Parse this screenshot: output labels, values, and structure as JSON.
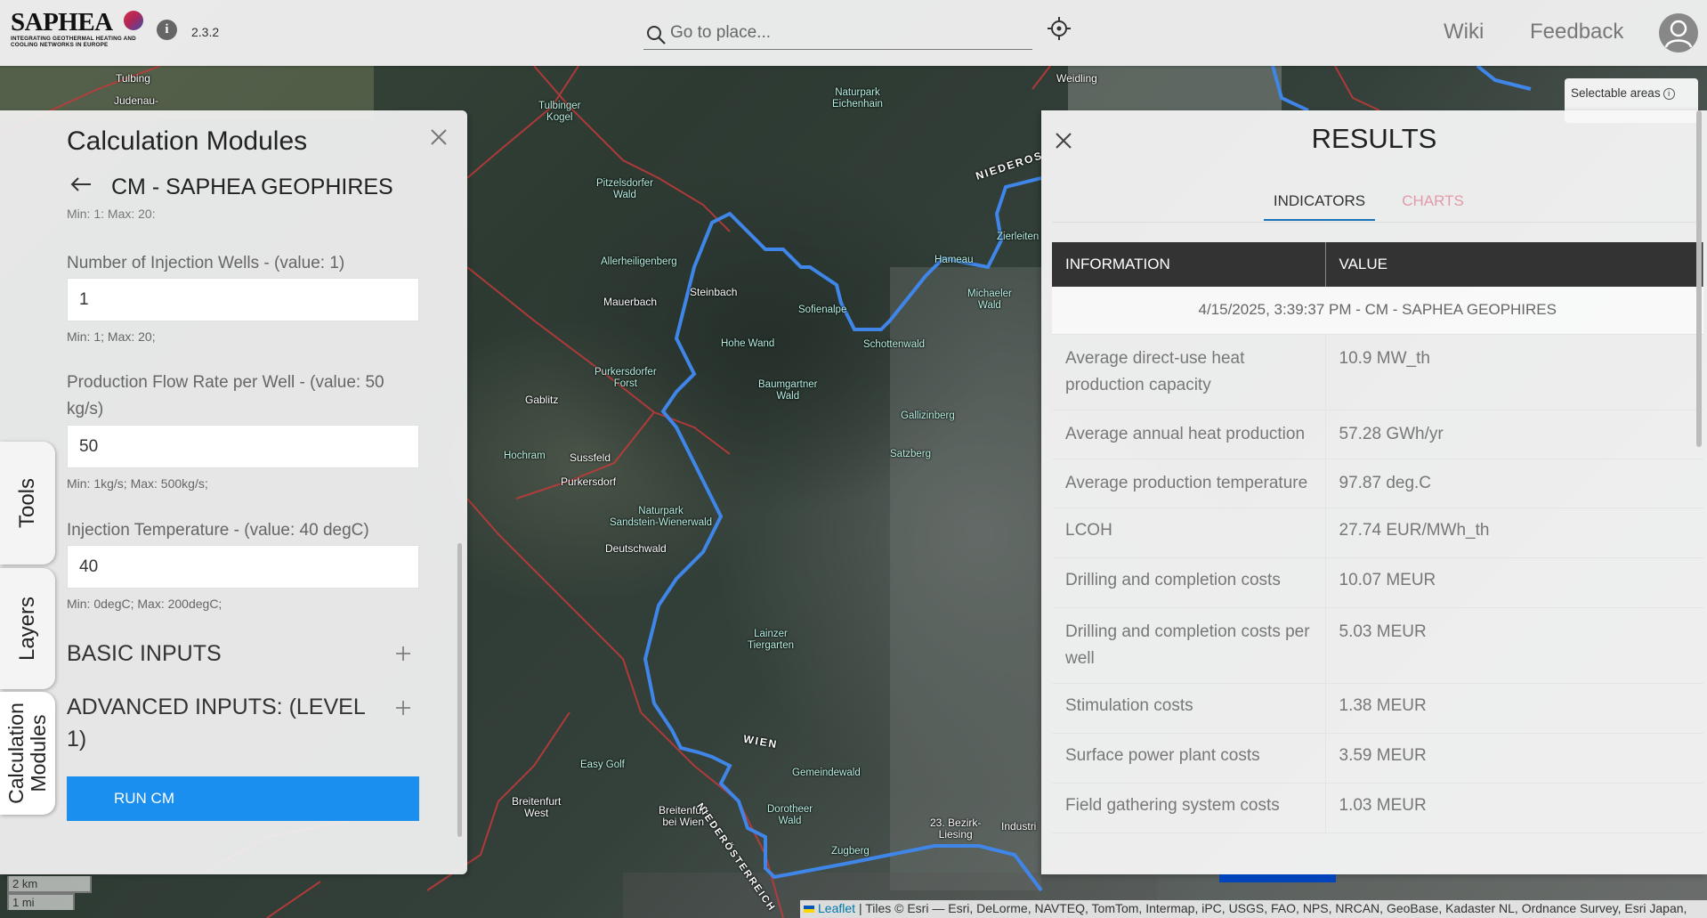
{
  "header": {
    "logo": {
      "wordmark": "SAPHEA",
      "tagline": "INTEGRATING GEOTHERMAL HEATING AND COOLING NETWORKS IN EUROPE"
    },
    "version": "2.3.2",
    "search_placeholder": "Go to place...",
    "wiki_label": "Wiki",
    "feedback_label": "Feedback"
  },
  "map": {
    "selectable_areas_label": "Selectable areas",
    "places": [
      {
        "label": "Tulbing",
        "kind": "town"
      },
      {
        "label": "Weidling",
        "kind": "town"
      },
      {
        "label": "Judenau-",
        "kind": "town"
      },
      {
        "label": "Tulbinger\nKogel",
        "kind": "wood"
      },
      {
        "label": "Naturpark\nEichenhain",
        "kind": "wood"
      },
      {
        "label": "Pitzelsdorfer\nWald",
        "kind": "wood"
      },
      {
        "label": "Allerheiligenberg",
        "kind": "wood"
      },
      {
        "label": "Mauerbach",
        "kind": "town"
      },
      {
        "label": "Steinbach",
        "kind": "town"
      },
      {
        "label": "Sofienalpe",
        "kind": "wood"
      },
      {
        "label": "Hohe Wand",
        "kind": "wood"
      },
      {
        "label": "Schottenwald",
        "kind": "wood"
      },
      {
        "label": "Hameau",
        "kind": "wood"
      },
      {
        "label": "Michaeler\nWald",
        "kind": "wood"
      },
      {
        "label": "Zierleiten",
        "kind": "wood"
      },
      {
        "label": "Purkersdorfer\nForst",
        "kind": "wood"
      },
      {
        "label": "Baumgartner\nWald",
        "kind": "wood"
      },
      {
        "label": "Gablitz",
        "kind": "town"
      },
      {
        "label": "Gallizinberg",
        "kind": "wood"
      },
      {
        "label": "Hochram",
        "kind": "wood"
      },
      {
        "label": "Sussfeld",
        "kind": "town"
      },
      {
        "label": "Satzberg",
        "kind": "wood"
      },
      {
        "label": "Purkersdorf",
        "kind": "town"
      },
      {
        "label": "Naturpark\nSandstein-Wienerwald",
        "kind": "wood"
      },
      {
        "label": "Deutschwald",
        "kind": "town"
      },
      {
        "label": "Lainzer\nTiergarten",
        "kind": "wood"
      },
      {
        "label": "WIEN",
        "kind": "road"
      },
      {
        "label": "Easy Golf",
        "kind": "wood"
      },
      {
        "label": "Gemeindewald",
        "kind": "wood"
      },
      {
        "label": "Breitenfurt\nWest",
        "kind": "town"
      },
      {
        "label": "Breitenfurt\nbei Wien",
        "kind": "town"
      },
      {
        "label": "Dorotheer\nWald",
        "kind": "wood"
      },
      {
        "label": "23. Bezirk-\nLiesing",
        "kind": "town"
      },
      {
        "label": "Zugberg",
        "kind": "wood"
      },
      {
        "label": "NIEDERÖSTERREICH",
        "kind": "road"
      },
      {
        "label": "NIEDEROS",
        "kind": "road"
      },
      {
        "label": "Industri",
        "kind": "town"
      }
    ],
    "scale_km": "2 km",
    "scale_mi": "1 mi",
    "attribution_link": "Leaflet",
    "attribution_text": "| Tiles © Esri — Esri, DeLorme, NAVTEQ, TomTom, Intermap, iPC, USGS, FAO, NPS, NRCAN, GeoBase, Kadaster NL, Ordnance Survey, Esri Japan,"
  },
  "side_tabs": {
    "tools": "Tools",
    "layers": "Layers",
    "calculation_modules": "Calculation\nModules"
  },
  "left_panel": {
    "title": "Calculation Modules",
    "cm_title": "CM - SAPHEA GEOPHIRES",
    "cut_hint": "Min: 1; Max: 20;",
    "fields": [
      {
        "label": "Number of Injection Wells - (value: 1)",
        "value": "1",
        "hint": "Min: 1; Max: 20;"
      },
      {
        "label": "Production Flow Rate per Well - (value: 50 kg/s)",
        "value": "50",
        "hint": "Min: 1kg/s; Max: 500kg/s;"
      },
      {
        "label": "Injection Temperature - (value: 40 degC)",
        "value": "40",
        "hint": "Min: 0degC; Max: 200degC;"
      }
    ],
    "sections": [
      "BASIC INPUTS",
      "ADVANCED INPUTS: (LEVEL 1)"
    ],
    "run_label": "RUN CM"
  },
  "results": {
    "title": "RESULTS",
    "tabs": [
      "INDICATORS",
      "CHARTS"
    ],
    "columns": [
      "INFORMATION",
      "VALUE"
    ],
    "run_line": "4/15/2025, 3:39:37 PM - CM - SAPHEA GEOPHIRES",
    "rows": [
      {
        "info": "Average direct-use heat production capacity",
        "value": "10.9 MW_th"
      },
      {
        "info": "Average annual heat production",
        "value": "57.28 GWh/yr"
      },
      {
        "info": "Average production temperature",
        "value": "97.87 deg.C"
      },
      {
        "info": "LCOH",
        "value": "27.74 EUR/MWh_th"
      },
      {
        "info": "Drilling and completion costs",
        "value": "10.07 MEUR"
      },
      {
        "info": "Drilling and completion costs per well",
        "value": "5.03 MEUR"
      },
      {
        "info": "Stimulation costs",
        "value": "1.38 MEUR"
      },
      {
        "info": "Surface power plant costs",
        "value": "3.59 MEUR"
      },
      {
        "info": "Field gathering system costs",
        "value": "1.03 MEUR"
      }
    ]
  }
}
